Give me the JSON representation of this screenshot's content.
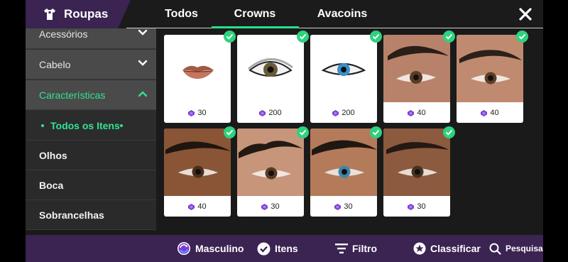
{
  "header": {
    "title": "Roupas",
    "tabs": [
      {
        "label": "Todos"
      },
      {
        "label": "Crowns"
      },
      {
        "label": "Avacoins"
      }
    ],
    "active_tab": "Crowns",
    "accent_color": "#29e08a",
    "icons": {
      "title": "shirt-icon",
      "close": "close-icon"
    }
  },
  "sidebar": {
    "categories": [
      {
        "label": "Acessórios",
        "expanded": false
      },
      {
        "label": "Cabelo",
        "expanded": false
      },
      {
        "label": "Características",
        "expanded": true
      }
    ],
    "subitems": [
      {
        "label": "Todos os Itens",
        "selected": true
      },
      {
        "label": "Olhos"
      },
      {
        "label": "Boca"
      },
      {
        "label": "Sobrancelhas"
      }
    ]
  },
  "items": [
    {
      "name": "lips",
      "price": "30",
      "owned": true
    },
    {
      "name": "eye-dark",
      "price": "200",
      "owned": true
    },
    {
      "name": "eye-blue",
      "price": "200",
      "owned": true
    },
    {
      "name": "brows-1",
      "price": "40",
      "owned": true
    },
    {
      "name": "brows-2",
      "price": "40",
      "owned": true
    },
    {
      "name": "brows-3",
      "price": "40",
      "owned": true
    },
    {
      "name": "brows-4",
      "price": "30",
      "owned": true
    },
    {
      "name": "brows-5",
      "price": "30",
      "owned": true
    },
    {
      "name": "brows-6",
      "price": "30",
      "owned": true
    }
  ],
  "bottom_bar": {
    "masculino": "Masculino",
    "itens": "Itens",
    "filtro": "Filtro",
    "classificar": "Classificar",
    "pesquisa": "Pesquisa"
  },
  "colors": {
    "brand_purple": "#3b2352",
    "check_green": "#2dd27d",
    "currency_purple": "#7a3bd6"
  }
}
